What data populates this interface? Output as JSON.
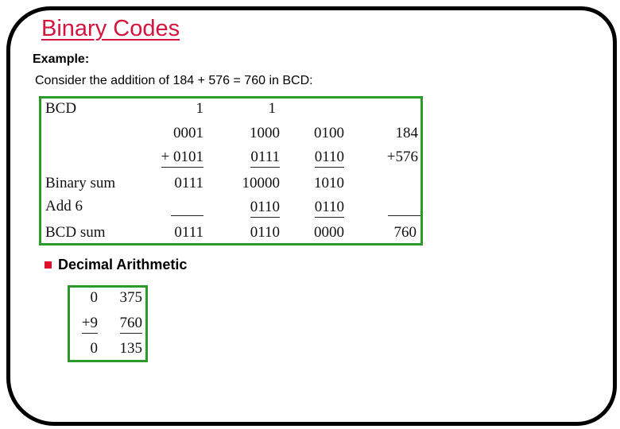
{
  "slide": {
    "title": "Binary Codes",
    "example_label": "Example:",
    "description": "Consider the addition of 184 + 576 = 760 in BCD:"
  },
  "bcd_table": {
    "rows": [
      {
        "label": "BCD",
        "cols": [
          "1",
          "1",
          "",
          ""
        ]
      },
      {
        "label": "",
        "cols": [
          "0001",
          "1000",
          "0100",
          "184"
        ]
      },
      {
        "label": "",
        "cols": [
          "+ 0101",
          "0111",
          "0110",
          "+576"
        ]
      },
      {
        "label": "Binary sum",
        "cols": [
          "0111",
          "10000",
          "1010",
          ""
        ]
      },
      {
        "label": "Add 6",
        "cols": [
          "",
          "0110",
          "0110",
          ""
        ]
      },
      {
        "label": "BCD sum",
        "cols": [
          "0111",
          "0110",
          "0000",
          "760"
        ]
      }
    ]
  },
  "section": {
    "bullet_label": "Decimal Arithmetic"
  },
  "decimal_table": {
    "rows": [
      {
        "cols": [
          "0",
          "375"
        ]
      },
      {
        "cols": [
          "+9",
          "760"
        ]
      },
      {
        "cols": [
          "0",
          "135"
        ]
      }
    ]
  },
  "colors": {
    "title": "#d4143c",
    "box_border": "#2a9a2a",
    "bullet": "#e0102c"
  }
}
